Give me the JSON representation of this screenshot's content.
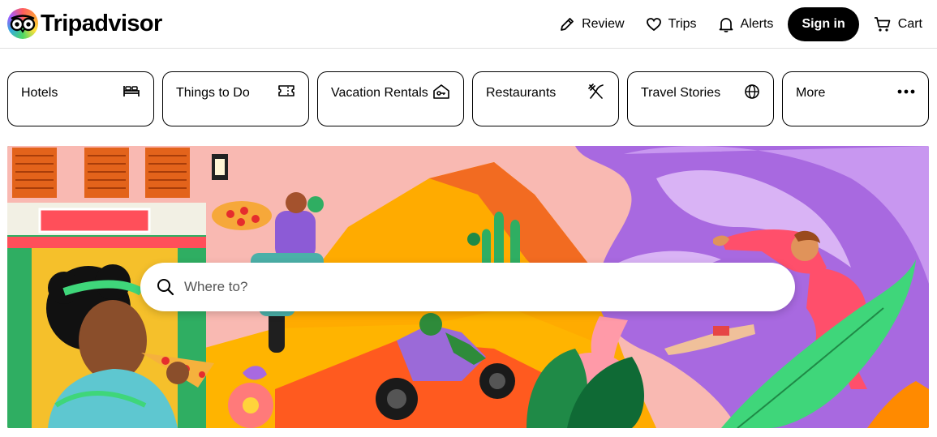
{
  "header": {
    "brand": "Tripadvisor",
    "nav": {
      "review": "Review",
      "trips": "Trips",
      "alerts": "Alerts",
      "sign_in": "Sign in",
      "cart": "Cart"
    }
  },
  "categories": [
    {
      "label": "Hotels",
      "icon": "bed-icon"
    },
    {
      "label": "Things to Do",
      "icon": "ticket-icon"
    },
    {
      "label": "Vacation Rentals",
      "icon": "house-key-icon"
    },
    {
      "label": "Restaurants",
      "icon": "fork-knife-icon"
    },
    {
      "label": "Travel Stories",
      "icon": "globe-icon"
    },
    {
      "label": "More",
      "icon": "more-dots-icon"
    }
  ],
  "hero": {
    "search_placeholder": "Where to?"
  },
  "colors": {
    "primary": "#000000",
    "background": "#ffffff",
    "hero_orange": "#ffab00",
    "hero_pink": "#f7b3b3",
    "hero_purple": "#a869e0",
    "hero_green": "#2fae62"
  }
}
